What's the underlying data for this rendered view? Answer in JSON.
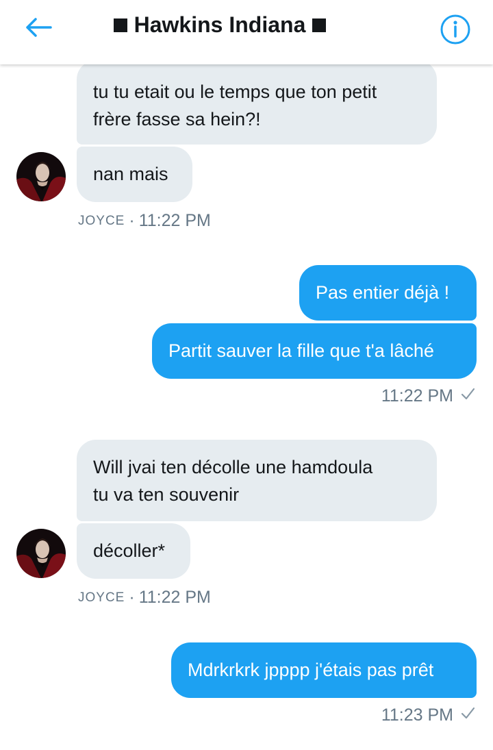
{
  "header": {
    "title": "Hawkins Indiana",
    "back_icon": "arrow-left-icon",
    "info_icon": "info-icon",
    "accent_color": "#1da1f2"
  },
  "messages": [
    {
      "direction": "in",
      "text_lines": [
        "tu tu etait ou le temps que ton petit",
        "frère fasse sa hein?!"
      ]
    },
    {
      "direction": "in",
      "text_lines": [
        "nan mais"
      ]
    },
    {
      "direction": "out",
      "text_lines": [
        "Pas entier déjà !"
      ]
    },
    {
      "direction": "out",
      "text_lines": [
        "Partit sauver la fille que t'a lâché"
      ]
    },
    {
      "direction": "in",
      "text_lines": [
        "Will jvai ten décolle une hamdoula",
        "tu va ten souvenir"
      ]
    },
    {
      "direction": "in",
      "text_lines": [
        "décoller*"
      ]
    },
    {
      "direction": "out",
      "text_lines": [
        "Mdrkrkrk jpppp j'étais pas prêt"
      ]
    }
  ],
  "meta": [
    {
      "sender": "JOYCE",
      "separator": "·",
      "time": "11:22 PM"
    },
    {
      "time": "11:22 PM",
      "status_icon": "checkmark-icon"
    },
    {
      "sender": "JOYCE",
      "separator": "·",
      "time": "11:22 PM"
    },
    {
      "time": "11:23 PM",
      "status_icon": "checkmark-icon"
    }
  ],
  "colors": {
    "incoming_bubble": "#e6ecf0",
    "outgoing_bubble": "#1da1f2",
    "meta_text": "#657786"
  }
}
